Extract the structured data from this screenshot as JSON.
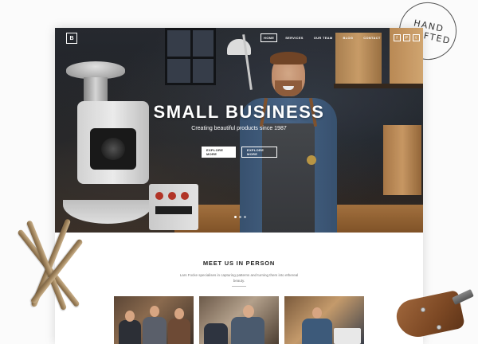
{
  "stamp": {
    "line1": "HAND",
    "line2": "CRAFTED"
  },
  "header": {
    "logo": "B",
    "nav": [
      {
        "label": "HOME",
        "active": true
      },
      {
        "label": "SERVICES",
        "active": false
      },
      {
        "label": "OUR TEAM",
        "active": false
      },
      {
        "label": "BLOG",
        "active": false
      },
      {
        "label": "CONTACT",
        "active": false
      }
    ],
    "social": [
      {
        "icon": "facebook-icon",
        "glyph": "f"
      },
      {
        "icon": "pinterest-icon",
        "glyph": "P"
      },
      {
        "icon": "twitter-icon",
        "glyph": "t"
      }
    ]
  },
  "hero": {
    "title": "SMALL BUSINESS",
    "subtitle": "Creating beautiful products since 1987",
    "buttons": [
      "EXPLORE MORE",
      "EXPLORE MORE"
    ],
    "slides": 3,
    "active_slide": 0
  },
  "meet": {
    "title": "MEET US IN PERSON",
    "text": "Lars Focke specialises in capturing patterns and turning them into ethereal beauty."
  },
  "colors": {
    "background": "#fbfbfb",
    "hero_overlay": "#1f2227",
    "text_dark": "#222222",
    "text_muted": "#777777"
  }
}
